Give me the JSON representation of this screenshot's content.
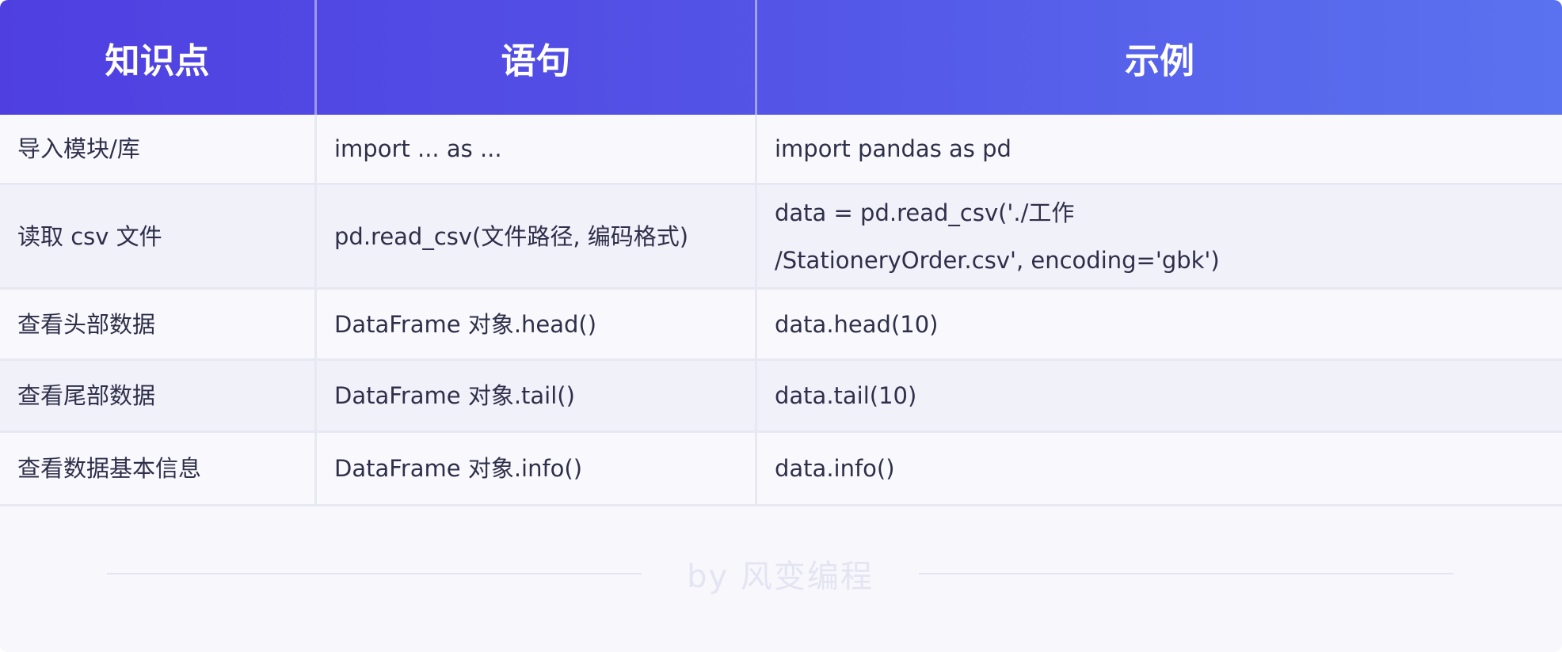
{
  "table": {
    "headers": [
      "知识点",
      "语句",
      "示例"
    ],
    "rows": [
      {
        "topic": "导入模块/库",
        "statement": "import ... as ...",
        "example": "import pandas as pd"
      },
      {
        "topic": "读取 csv 文件",
        "statement": "pd.read_csv(文件路径, 编码格式)",
        "example_line1": "data = pd.read_csv('./工作",
        "example_line2": "/StationeryOrder.csv', encoding='gbk')"
      },
      {
        "topic": "查看头部数据",
        "statement": "DataFrame 对象.head()",
        "example": "data.head(10)"
      },
      {
        "topic": "查看尾部数据",
        "statement": "DataFrame 对象.tail()",
        "example": "data.tail(10)"
      },
      {
        "topic": "查看数据基本信息",
        "statement": "DataFrame 对象.info()",
        "example": "data.info()"
      }
    ]
  },
  "footer": {
    "credit": "by 风变编程"
  }
}
